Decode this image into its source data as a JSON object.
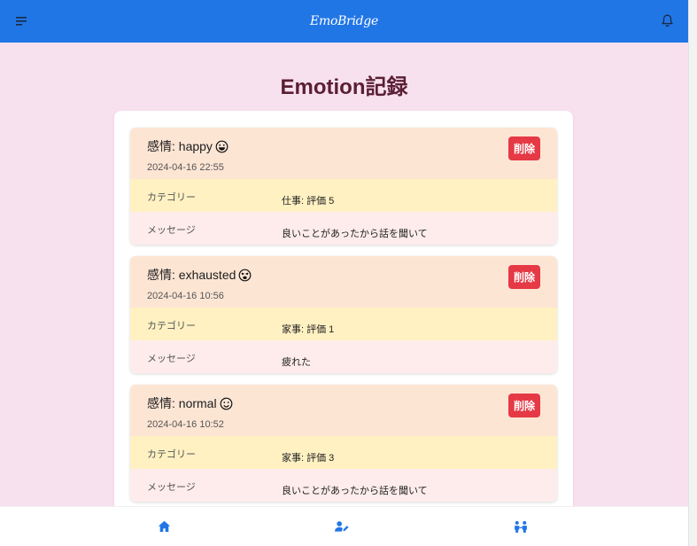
{
  "app": {
    "logo_text": "EmoBridge",
    "header_color": "#2176e6"
  },
  "page": {
    "title": "Emotion記録"
  },
  "records": [
    {
      "emotion_label": "感情: happy",
      "emoji_icon": "grinning-face-icon",
      "date": "2024-04-16 22:55",
      "delete_label": "削除",
      "category_key": "カテゴリー",
      "category_value": "仕事: 評価 5",
      "message_key": "メッセージ",
      "message_value": "良いことがあったから話を聞いて"
    },
    {
      "emotion_label": "感情: exhausted",
      "emoji_icon": "tired-face-icon",
      "date": "2024-04-16 10:56",
      "delete_label": "削除",
      "category_key": "カテゴリー",
      "category_value": "家事: 評価 1",
      "message_key": "メッセージ",
      "message_value": "疲れた"
    },
    {
      "emotion_label": "感情: normal",
      "emoji_icon": "slightly-smiling-face-icon",
      "date": "2024-04-16 10:52",
      "delete_label": "削除",
      "category_key": "カテゴリー",
      "category_value": "家事: 評価 3",
      "message_key": "メッセージ",
      "message_value": "良いことがあったから話を聞いて"
    }
  ],
  "bottom_nav": {
    "items": [
      "home-icon",
      "user-edit-icon",
      "people-icon"
    ],
    "accent": "#2176e6"
  }
}
